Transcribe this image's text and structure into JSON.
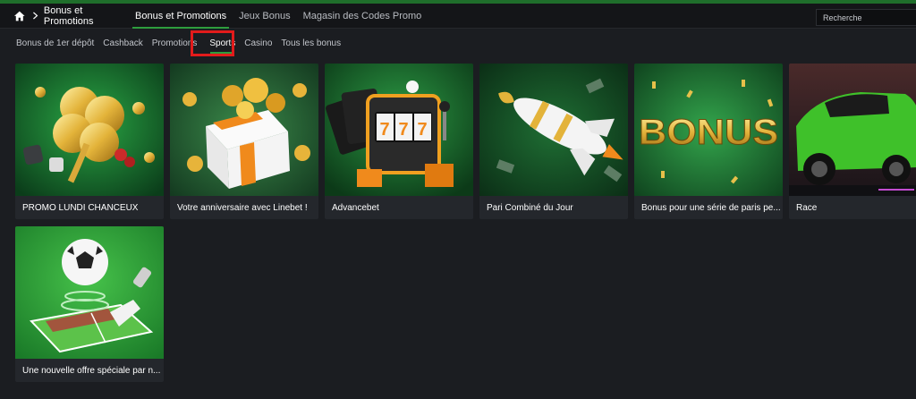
{
  "breadcrumb": {
    "label": "Bonus et Promotions",
    "home_icon": "home-icon"
  },
  "top_nav": [
    {
      "label": "Bonus et Promotions",
      "active": true
    },
    {
      "label": "Jeux Bonus",
      "active": false
    },
    {
      "label": "Magasin des Codes Promo",
      "active": false
    }
  ],
  "search": {
    "placeholder": "Recherche"
  },
  "sub_nav": [
    {
      "label": "Bonus de 1er dépôt",
      "active": false
    },
    {
      "label": "Cashback",
      "active": false
    },
    {
      "label": "Promotions",
      "active": false
    },
    {
      "label": "Sports",
      "active": true
    },
    {
      "label": "Casino",
      "active": false
    },
    {
      "label": "Tous les bonus",
      "active": false
    }
  ],
  "cards": [
    {
      "title": "PROMO LUNDI CHANCEUX",
      "art": "clover-image"
    },
    {
      "title": "Votre anniversaire avec Linebet !",
      "art": "gift-box-image"
    },
    {
      "title": "Advancebet",
      "art": "slot-machine-image"
    },
    {
      "title": "Pari Combiné du Jour",
      "art": "rocket-image"
    },
    {
      "title": "Bonus pour une série de paris pe...",
      "art": "bonus-text-image",
      "art_text": "BONUS"
    },
    {
      "title": "Race",
      "art": "race-car-image"
    },
    {
      "title": "Une nouvelle offre spéciale par n...",
      "art": "football-image"
    }
  ],
  "colors": {
    "accent": "#2e9e3d",
    "highlight": "#e21b1b",
    "background": "#1b1d21",
    "card": "#24272c"
  }
}
